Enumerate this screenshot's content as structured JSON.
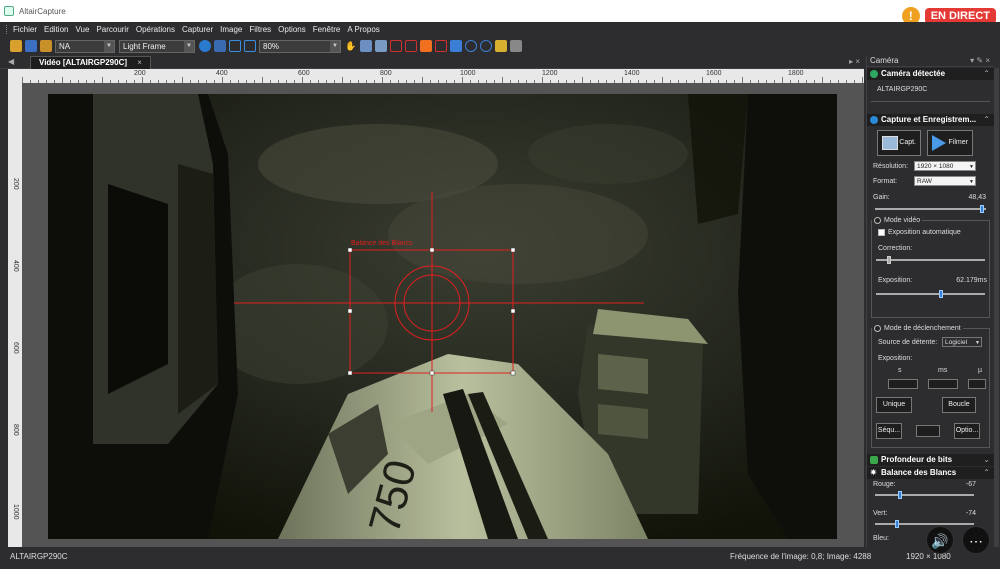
{
  "window": {
    "title": "AltairCapture"
  },
  "live": {
    "warning": "!",
    "badge": "EN DIRECT"
  },
  "menu": [
    "Fichier",
    "Edition",
    "Vue",
    "Parcourir",
    "Opérations",
    "Capturer",
    "Image",
    "Filtres",
    "Options",
    "Fenêtre",
    "A Propos"
  ],
  "toolbar": {
    "combo1": "NA",
    "combo2": "Light Frame",
    "zoom": "80%"
  },
  "doc": {
    "tab_label": "Vidéo [ALTAIRGP290C]",
    "close": "×"
  },
  "rulers": {
    "top": [
      "200",
      "400",
      "600",
      "800",
      "1000",
      "1200",
      "1400",
      "1600",
      "1800"
    ],
    "left": [
      "200",
      "400",
      "600",
      "800",
      "1000"
    ]
  },
  "overlay": {
    "label": "Balance des Blancs"
  },
  "panel": {
    "title": "Caméra",
    "camera_detected": "Caméra détectée",
    "camera_name": "ALTAIRGP290C",
    "capture_section": "Capture et Enregistrem...",
    "capture_button": "Capt.",
    "record_button": "Filmer",
    "resolution_label": "Résolution:",
    "resolution_value": "1920 × 1080",
    "format_label": "Format:",
    "format_value": "RAW",
    "gain_label": "Gain:",
    "gain_value": "48,43",
    "gain_level": 0.96,
    "video_mode": "Mode vidéo",
    "auto_exposure": "Exposition automatique",
    "correction_label": "Correction:",
    "correction_level": 0.12,
    "exposure_label": "Exposition:",
    "exposure_value": "62.179ms",
    "exposure_level": 0.6,
    "trigger_mode": "Mode de déclenchement",
    "trigger_source_label": "Source de détente:",
    "trigger_source_value": "Logiciel",
    "trigger_exposure_label": "Exposition:",
    "unit_s": "s",
    "unit_ms": "ms",
    "unit_us": "µ",
    "single_button": "Unique",
    "loop_button": "Boucle",
    "sequence_button": "Séqu...",
    "options_button": "Optio...",
    "bit_depth_section": "Profondeur de bits",
    "wb_section": "Balance des Blancs",
    "red_label": "Rouge:",
    "red_value": "-67",
    "red_level": 0.25,
    "green_label": "Vert:",
    "green_value": "-74",
    "green_level": 0.22,
    "blue_label": "Bleu:"
  },
  "status": {
    "camera": "ALTAIRGP290C",
    "frame_rate": "Fréquence de l'image: 0,8; Image: 4288",
    "resolution": "1920 × 1080"
  },
  "colors": {
    "crosshair": "#e02020",
    "live_badge": "#e53935",
    "accent": "#3b7dd8"
  }
}
